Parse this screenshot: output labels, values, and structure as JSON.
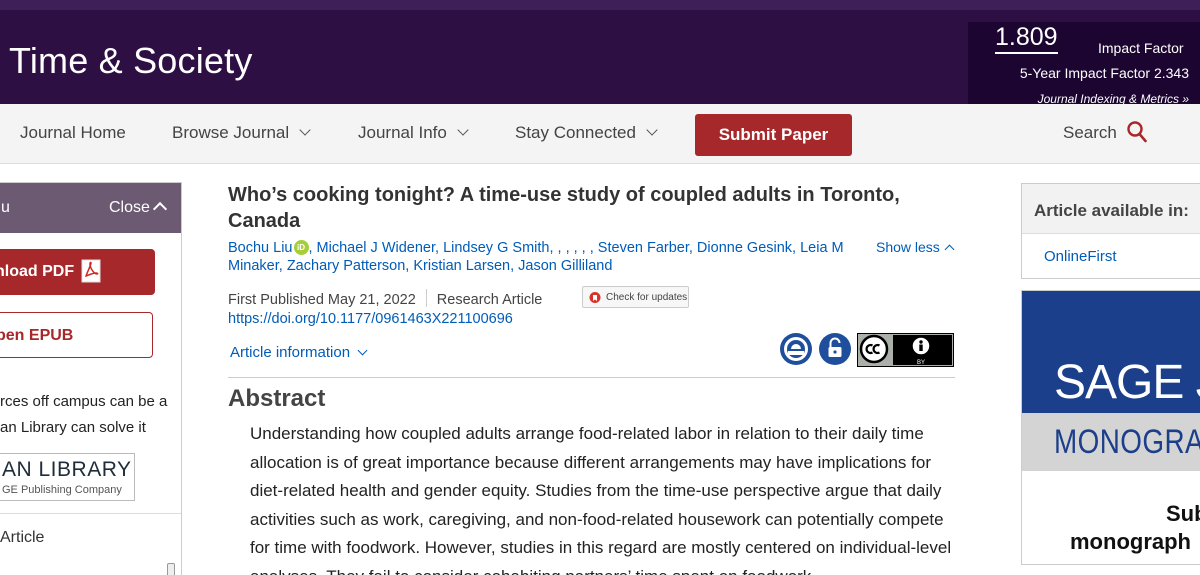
{
  "header": {
    "journal_title": "Time & Society",
    "impact_factor_value": "1.809",
    "impact_factor_label": "Impact Factor",
    "five_year_impact": "5-Year Impact Factor 2.343",
    "indexing_link": "Journal Indexing & Metrics »"
  },
  "nav": {
    "journal_home": "Journal Home",
    "browse_journal": "Browse Journal",
    "journal_info": "Journal Info",
    "stay_connected": "Stay Connected",
    "submit_paper": "Submit Paper",
    "search": "Search"
  },
  "left_panel": {
    "header_fragment": "u",
    "close_label": "Close",
    "download_pdf": "nload PDF",
    "open_epub": "pen EPUB",
    "access_text": "rces off campus can be a an Library can solve it",
    "library_name": "AN LIBRARY",
    "library_sub": "GE Publishing Company",
    "article_label": "Article"
  },
  "article": {
    "title": "Who’s cooking tonight? A time-use study of coupled adults in Toronto, Canada",
    "authors_first": "Bochu Liu",
    "orcid_label": "iD",
    "authors_rest": ", Michael J Widener, Lindsey G Smith, , , , , , Steven Farber, Dionne Gesink, Leia M Minaker, Zachary Patterson, Kristian Larsen, Jason Gilliland",
    "show_less": "Show less",
    "first_published": "First Published May 21, 2022",
    "article_type": "Research Article",
    "check_updates": "Check for updates",
    "doi": "https://doi.org/10.1177/0961463X221100696",
    "article_information": "Article information",
    "abstract_heading": "Abstract",
    "abstract_text": "Understanding how coupled adults arrange food-related labor in relation to their daily time allocation is of great importance because different arrangements may have implications for diet-related health and gender equity. Studies from the time-use perspective argue that daily activities such as work, caregiving, and non-food-related housework can potentially compete for time with foodwork. However, studies in this regard are mostly centered on individual-level analyses. They fail to consider cohabiting partners’ time spent on foodwork"
  },
  "right_panel": {
    "available_in": "Article available in:",
    "online_first": "OnlineFirst",
    "ad_sage": "SAGE J",
    "ad_monographs": "MONOGRAPHS",
    "ad_sub": "Sub",
    "ad_monograph": "monograph"
  },
  "colors": {
    "header_bg": "#2d0f44",
    "metrics_bg": "#1c0631",
    "accent_red": "#a7282b",
    "link_blue": "#005cb9",
    "ad_blue": "#1b3f8a"
  }
}
